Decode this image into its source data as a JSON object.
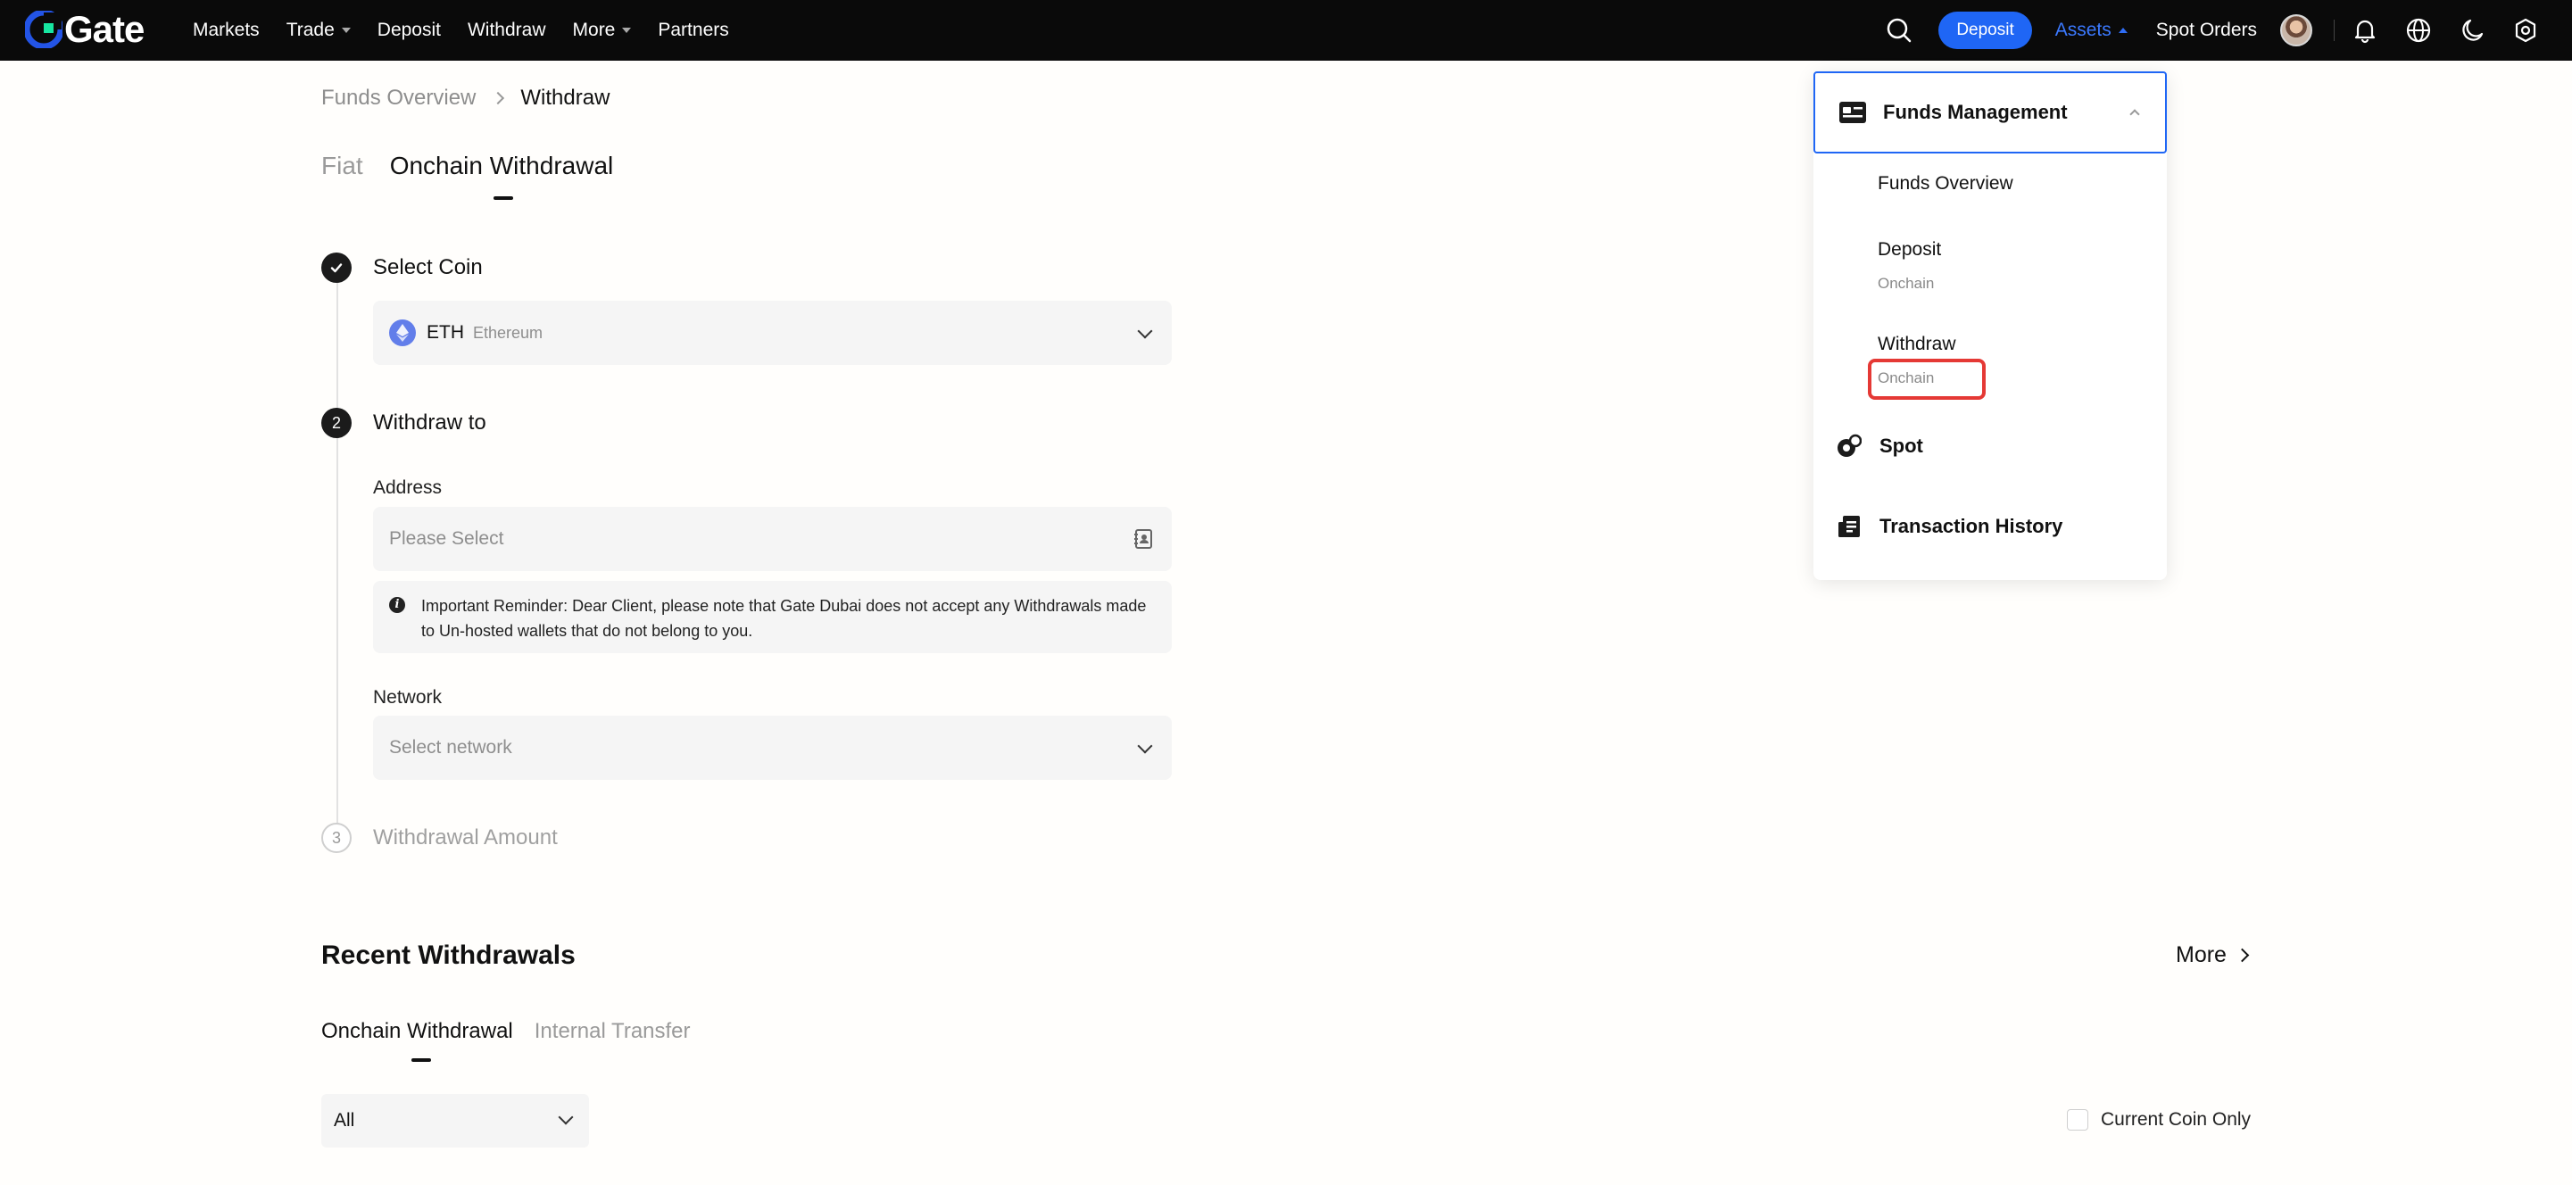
{
  "header": {
    "logo_text": "Gate",
    "nav": [
      {
        "label": "Markets",
        "has_caret": false
      },
      {
        "label": "Trade",
        "has_caret": true
      },
      {
        "label": "Deposit",
        "has_caret": false
      },
      {
        "label": "Withdraw",
        "has_caret": false
      },
      {
        "label": "More",
        "has_caret": true
      },
      {
        "label": "Partners",
        "has_caret": false
      }
    ],
    "deposit_button": "Deposit",
    "assets_label": "Assets",
    "spot_orders_label": "Spot Orders",
    "accent_color": "#1f66f5"
  },
  "breadcrumb": {
    "parent": "Funds Overview",
    "current": "Withdraw"
  },
  "tabs": {
    "fiat": "Fiat",
    "onchain": "Onchain Withdrawal"
  },
  "steps": {
    "step1": {
      "title": "Select Coin",
      "state": "done"
    },
    "step2": {
      "number": "2",
      "title": "Withdraw to",
      "state": "active"
    },
    "step3": {
      "number": "3",
      "title": "Withdrawal Amount",
      "state": "pending"
    }
  },
  "coin": {
    "symbol": "ETH",
    "name": "Ethereum"
  },
  "address": {
    "label": "Address",
    "placeholder": "Please Select"
  },
  "notice": {
    "text": "Important Reminder: Dear Client, please note that Gate Dubai does not accept any Withdrawals made to Un-hosted wallets that do not belong to you."
  },
  "network": {
    "label": "Network",
    "placeholder": "Select network"
  },
  "recent": {
    "title": "Recent Withdrawals",
    "more": "More",
    "tab_onchain": "Onchain Withdrawal",
    "tab_internal": "Internal Transfer",
    "filter_value": "All",
    "current_coin_only": "Current Coin Only"
  },
  "funds_menu": {
    "header": "Funds Management",
    "funds_overview": "Funds Overview",
    "deposit": "Deposit",
    "deposit_sub": "Onchain",
    "withdraw": "Withdraw",
    "withdraw_sub": "Onchain",
    "spot": "Spot",
    "transaction_history": "Transaction History"
  }
}
